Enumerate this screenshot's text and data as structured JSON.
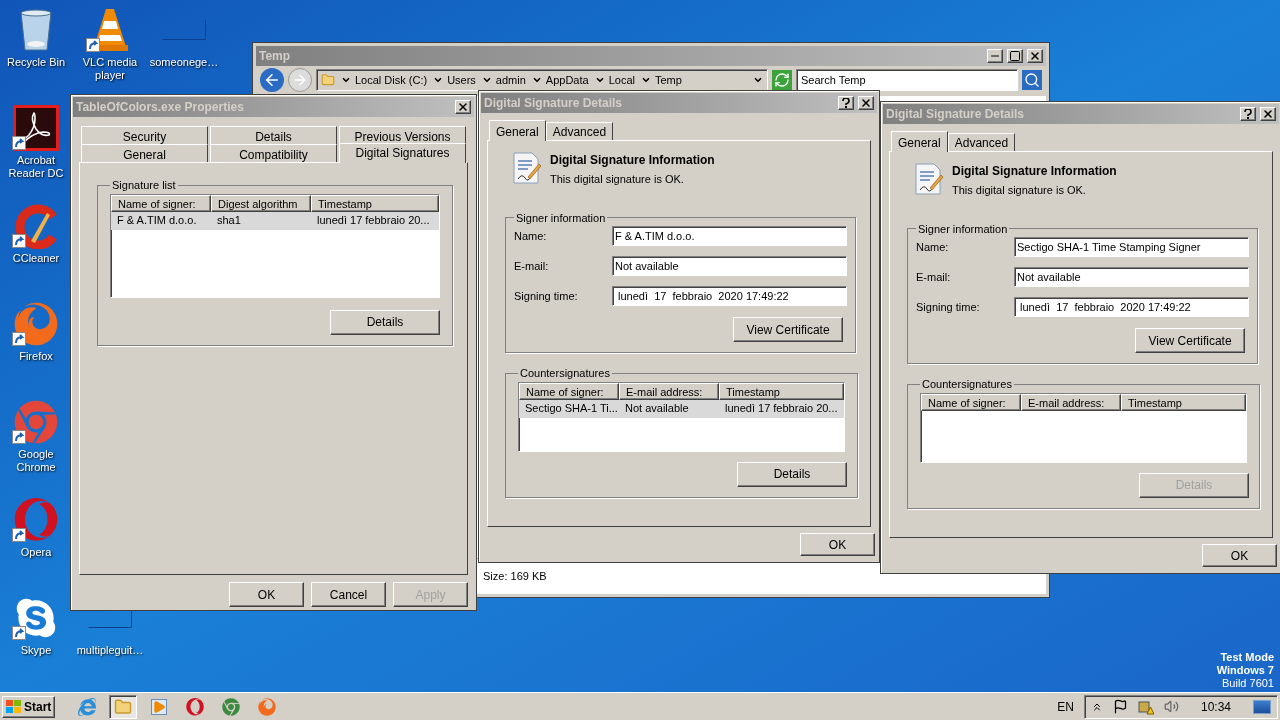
{
  "desktop_icons": [
    {
      "label": "Recycle Bin",
      "kind": "recycle",
      "shortcut": false
    },
    {
      "label": "VLC media player",
      "kind": "vlc",
      "shortcut": true
    },
    {
      "label": "someonege…",
      "kind": "blank",
      "shortcut": false
    },
    {
      "label": "Acrobat Reader DC",
      "kind": "acrobat",
      "shortcut": true
    },
    {
      "label": "CCleaner",
      "kind": "ccleaner",
      "shortcut": true
    },
    {
      "label": "Firefox",
      "kind": "firefox",
      "shortcut": true
    },
    {
      "label": "Google Chrome",
      "kind": "chrome",
      "shortcut": true
    },
    {
      "label": "Opera",
      "kind": "opera",
      "shortcut": true
    },
    {
      "label": "Skype",
      "kind": "skype",
      "shortcut": true
    },
    {
      "label": "multipleguit…",
      "kind": "blank",
      "shortcut": false
    }
  ],
  "explorer": {
    "title": "Temp",
    "breadcrumbs": [
      "Local Disk (C:)",
      "Users",
      "admin",
      "AppData",
      "Local",
      "Temp"
    ],
    "search": {
      "placeholder": "Search Temp"
    },
    "status": "Size: 169 KB"
  },
  "properties": {
    "title": "TableOfColors.exe Properties",
    "tab_rows": [
      [
        {
          "label": "Security",
          "selected": false
        },
        {
          "label": "Details",
          "selected": false
        },
        {
          "label": "Previous Versions",
          "selected": false
        }
      ],
      [
        {
          "label": "General",
          "selected": false
        },
        {
          "label": "Compatibility",
          "selected": false
        },
        {
          "label": "Digital Signatures",
          "selected": true
        }
      ]
    ],
    "group": "Signature list",
    "columns": [
      "Name of signer:",
      "Digest algorithm",
      "Timestamp"
    ],
    "rows": [
      {
        "cells": [
          "F & A.TIM d.o.o.",
          "sha1",
          "lunedì 17 febbraio 20..."
        ],
        "selected": true
      }
    ],
    "details_button": {
      "label": "Details",
      "disabled": false
    },
    "buttons": [
      {
        "label": "OK",
        "disabled": false
      },
      {
        "label": "Cancel",
        "disabled": false
      },
      {
        "label": "Apply",
        "disabled": true
      }
    ]
  },
  "signature_dialogs": [
    {
      "title": "Digital Signature Details",
      "tabs": [
        {
          "label": "General",
          "selected": true
        },
        {
          "label": "Advanced",
          "selected": false
        }
      ],
      "heading": "Digital Signature Information",
      "status": "This digital signature is OK.",
      "signer_group": "Signer information",
      "fields": [
        {
          "label": "Name:",
          "value": "F & A.TIM d.o.o."
        },
        {
          "label": "E-mail:",
          "value": "Not available"
        },
        {
          "label": "Signing time:",
          "value": " lunedì  17  febbraio  2020 17:49:22"
        }
      ],
      "view_button": {
        "label": "View Certificate",
        "disabled": false
      },
      "counter_group": "Countersignatures",
      "columns": [
        "Name of signer:",
        "E-mail address:",
        "Timestamp"
      ],
      "rows": [
        {
          "cells": [
            "Sectigo SHA-1 Ti...",
            "Not available",
            "lunedì 17 febbraio 20..."
          ],
          "selected": true
        }
      ],
      "details_button": {
        "label": "Details",
        "disabled": false
      },
      "ok_button": "OK"
    },
    {
      "title": "Digital Signature Details",
      "tabs": [
        {
          "label": "General",
          "selected": true
        },
        {
          "label": "Advanced",
          "selected": false
        }
      ],
      "heading": "Digital Signature Information",
      "status": "This digital signature is OK.",
      "signer_group": "Signer information",
      "fields": [
        {
          "label": "Name:",
          "value": "Sectigo SHA-1 Time Stamping Signer"
        },
        {
          "label": "E-mail:",
          "value": "Not available"
        },
        {
          "label": "Signing time:",
          "value": " lunedì  17  febbraio  2020 17:49:22"
        }
      ],
      "view_button": {
        "label": "View Certificate",
        "disabled": false
      },
      "counter_group": "Countersignatures",
      "columns": [
        "Name of signer:",
        "E-mail address:",
        "Timestamp"
      ],
      "details_button": {
        "label": "Details",
        "disabled": true
      },
      "ok_button": "OK"
    }
  ],
  "test_mode": [
    "Test Mode",
    "Windows 7",
    "Build 7601"
  ],
  "taskbar": {
    "start": "Start",
    "apps": [
      {
        "kind": "ie",
        "selected": false
      },
      {
        "kind": "explorer",
        "selected": true
      },
      {
        "kind": "media",
        "selected": false
      },
      {
        "kind": "opera",
        "selected": false
      },
      {
        "kind": "chrome",
        "selected": false
      },
      {
        "kind": "firefox",
        "selected": false
      }
    ],
    "language": "EN",
    "clock": "10:34"
  }
}
